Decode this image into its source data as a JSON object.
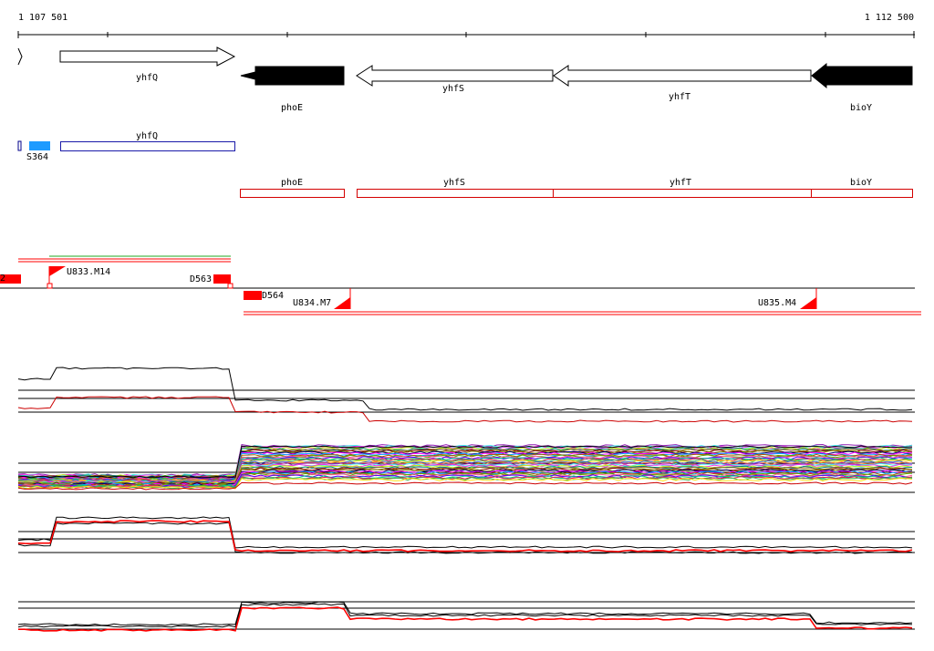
{
  "coordinates": {
    "start": "1 107 501",
    "end": "1 112 500"
  },
  "genes_track": [
    {
      "name": "",
      "strand": "+",
      "style": "outline"
    },
    {
      "name": "yhfQ",
      "strand": "+",
      "style": "outline"
    },
    {
      "name": "phoE",
      "strand": "-",
      "style": "filled"
    },
    {
      "name": "yhfS",
      "strand": "-",
      "style": "outline"
    },
    {
      "name": "yhfT",
      "strand": "-",
      "style": "outline"
    },
    {
      "name": "bioY",
      "strand": "-",
      "style": "filled"
    }
  ],
  "features_plus": [
    {
      "name": "",
      "color": "#00008b"
    },
    {
      "name": "S364",
      "color": "#1e9bff"
    },
    {
      "name": "yhfQ",
      "color": "#1a1aa8"
    }
  ],
  "features_minus": [
    {
      "name": "phoE",
      "color": "#d40000"
    },
    {
      "name": "yhfS",
      "color": "#d40000"
    },
    {
      "name": "yhfT",
      "color": "#d40000"
    },
    {
      "name": "bioY",
      "color": "#d40000"
    }
  ],
  "segments": {
    "plus": [
      {
        "name": "U833.M14"
      },
      {
        "name": "D563"
      }
    ],
    "minus": [
      {
        "name": "D564"
      },
      {
        "name": "U834.M7"
      },
      {
        "name": "U835.M4"
      }
    ],
    "left_edge_mark": "2"
  },
  "tracks": [
    {
      "name": "expression-plus-multi",
      "palette": "multicolor"
    },
    {
      "name": "expression-minus-multi",
      "palette": "multicolor"
    },
    {
      "name": "expression-plus-summary",
      "palette": "black-red"
    },
    {
      "name": "expression-minus-summary",
      "palette": "black-red"
    }
  ],
  "colors": {
    "axis": "#000000",
    "strand_minus": "#ff0000",
    "summary_red": "#ff0000",
    "feature_blue": "#1e9bff",
    "feature_navy": "#1a1aa8",
    "outline_red": "#d40000"
  }
}
